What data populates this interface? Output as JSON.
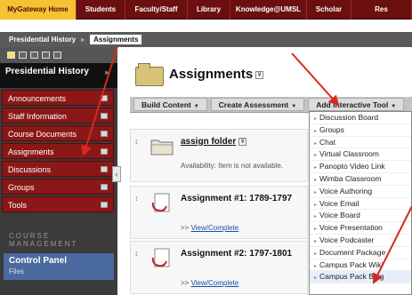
{
  "topnav": {
    "tabs": [
      "MyGateway Home",
      "Students",
      "Faculty/Staff",
      "Library",
      "Knowledge@UMSL",
      "Scholar",
      "Res"
    ]
  },
  "breadcrumb": {
    "parent": "Presidential History",
    "current": "Assignments"
  },
  "sidebar": {
    "course_title": "Presidential History",
    "items": [
      "Announcements",
      "Staff Information",
      "Course Documents",
      "Assignments",
      "Discussions",
      "Groups",
      "Tools"
    ],
    "section_label": "COURSE MANAGEMENT",
    "control_panel": "Control Panel",
    "control_panel_sub": "Files"
  },
  "main": {
    "page_title": "Assignments",
    "actions": {
      "build": "Build Content",
      "create": "Create Assessment",
      "add_tool": "Add Interactive Tool"
    },
    "items": [
      {
        "title": "assign folder",
        "meta": "Availability: Item is not available."
      },
      {
        "title": "Assignment #1: 1789-1797",
        "link_prefix": ">> ",
        "link": "View/Complete"
      },
      {
        "title": "Assignment #2: 1797-1801",
        "link_prefix": ">> ",
        "link": "View/Complete"
      }
    ]
  },
  "dropdown": {
    "options": [
      "Discussion Board",
      "Groups",
      "Chat",
      "Virtual Classroom",
      "Panopto Video Link",
      "Wimba Classroom",
      "Voice Authoring",
      "Voice Email",
      "Voice Board",
      "Voice Presentation",
      "Voice Podcaster",
      "Document Package",
      "Campus Pack Wiki",
      "Campus Pack Blog"
    ]
  },
  "colors": {
    "nav_bg": "#6b0f0f",
    "nav_active": "#f6c232",
    "menu_item": "#8b1717",
    "arrow": "#d42a1c"
  }
}
